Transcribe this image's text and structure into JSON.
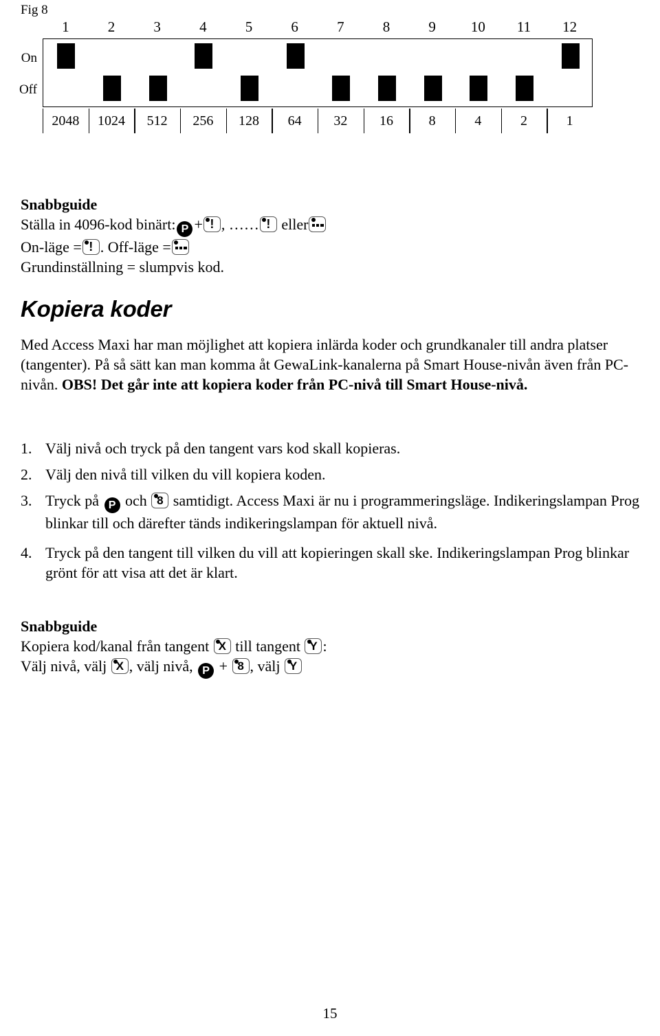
{
  "figure": {
    "label": "Fig 8",
    "row_labels": {
      "on": "On",
      "off": "Off"
    },
    "switch_numbers": [
      "1",
      "2",
      "3",
      "4",
      "5",
      "6",
      "7",
      "8",
      "9",
      "10",
      "11",
      "12"
    ],
    "scale_values": [
      "2048",
      "1024",
      "512",
      "256",
      "128",
      "64",
      "32",
      "16",
      "8",
      "4",
      "2",
      "1"
    ],
    "switch_states": [
      "on",
      "off",
      "off",
      "on",
      "off",
      "on",
      "off",
      "off",
      "off",
      "off",
      "off",
      "on"
    ]
  },
  "quickguide_top": {
    "title": "Snabbguide",
    "line1_prefix": "Ställa in 4096-kod binärt:",
    "line1_plus": "+",
    "line1_comma": ",",
    "line1_dots": "……",
    "line1_eller": "eller",
    "line2_on_prefix": "On-läge =",
    "line2_on_suffix": ".",
    "line2_off_prefix": "Off-läge =",
    "line3": "Grundinställning = slumpvis kod."
  },
  "section": {
    "title": "Kopiera koder",
    "paragraph_plain_1": "Med Access Maxi  har man möjlighet att kopiera inlärda koder och grundkanaler till andra platser (tangenter). På så sätt kan man komma åt GewaLink-kanalerna på Smart House-nivån även från PC-nivån. ",
    "paragraph_bold_1": "OBS! Det går inte att kopiera koder från PC-nivå till Smart House-nivå."
  },
  "steps": [
    {
      "num": "1.",
      "text": "Välj nivå och tryck på den tangent vars kod skall kopieras."
    },
    {
      "num": "2.",
      "text": "Välj den nivå till vilken du vill kopiera koden."
    },
    {
      "num": "3.",
      "text_a": "Tryck på",
      "text_b": "och",
      "text_c": "samtidigt. Access Maxi är nu i programmeringsläge. Indikeringslampan Prog blinkar till och därefter tänds indikeringslampan för aktuell nivå."
    },
    {
      "num": "4.",
      "text": "Tryck på den tangent till vilken du vill att kopieringen skall ske. Indikeringslampan Prog blinkar grönt för att visa att det är klart."
    }
  ],
  "quickguide_bottom": {
    "title": "Snabbguide",
    "line1_a": "Kopiera kod/kanal från tangent",
    "line1_b": "till tangent",
    "line1_c": ":",
    "line2_a": "Välj nivå, välj",
    "line2_b": ", välj nivå,",
    "line2_plus": "+",
    "line2_c": ", välj"
  },
  "keys": {
    "p_label": "P",
    "excl_label": "!",
    "eight_label": "8",
    "x_label": "X",
    "y_label": "Y"
  },
  "footer": {
    "page_number": "15"
  },
  "colors": {
    "ink": "#000000",
    "paper": "#ffffff",
    "key_border": "#555555"
  }
}
